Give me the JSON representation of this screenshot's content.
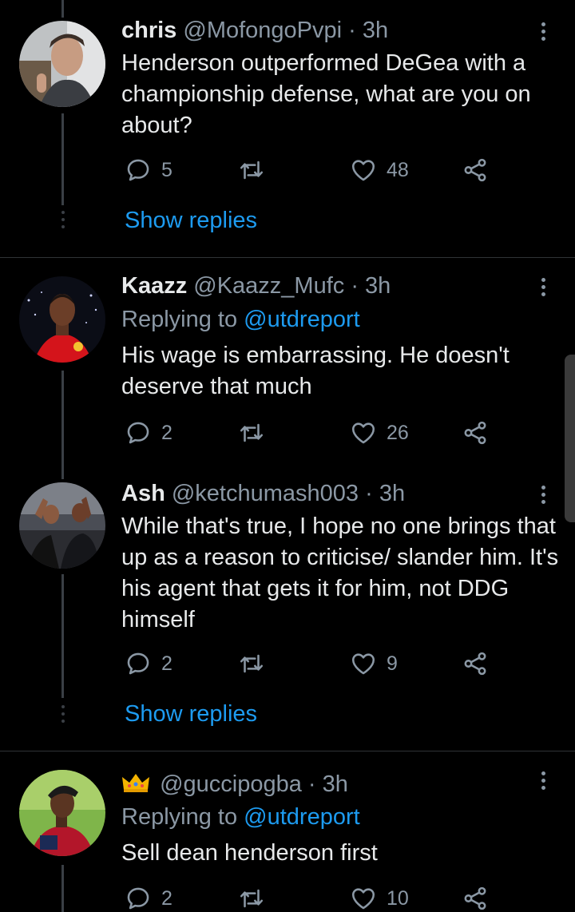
{
  "tweets": [
    {
      "name": "chris",
      "handle": "@MofongoPvpi",
      "time": "· 3h",
      "reply_prefix": "",
      "reply_to": "",
      "text": "Henderson outperformed DeGea with a championship defense, what are you on about?",
      "replies": "5",
      "retweets": "",
      "likes": "48",
      "show_replies": "Show replies"
    },
    {
      "name": "Kaazz",
      "handle": "@Kaazz_Mufc",
      "time": "· 3h",
      "reply_prefix": "Replying to",
      "reply_to": "@utdreport",
      "text": "His wage is embarrassing. He doesn't deserve that much",
      "replies": "2",
      "retweets": "",
      "likes": "26"
    },
    {
      "name": "Ash",
      "handle": "@ketchumash003",
      "time": "· 3h",
      "text": "While that's true, I hope no one brings that up as a reason to criticise/ slander him. It's his agent that gets it for him, not DDG himself",
      "replies": "2",
      "retweets": "",
      "likes": "9",
      "show_replies": "Show replies"
    },
    {
      "name": "",
      "handle": "@guccipogba",
      "time": "· 3h",
      "reply_prefix": "Replying to",
      "reply_to": "@utdreport",
      "text": "Sell dean henderson first",
      "replies": "2",
      "retweets": "",
      "likes": "10"
    }
  ],
  "colors": {
    "background": "#000000",
    "link": "#1d9bf0",
    "muted": "#8b98a5",
    "text": "#e7e9ea"
  },
  "icons": [
    "reply-icon",
    "retweet-icon",
    "like-icon",
    "share-icon",
    "more-options-icon",
    "crown-emoji-icon"
  ]
}
